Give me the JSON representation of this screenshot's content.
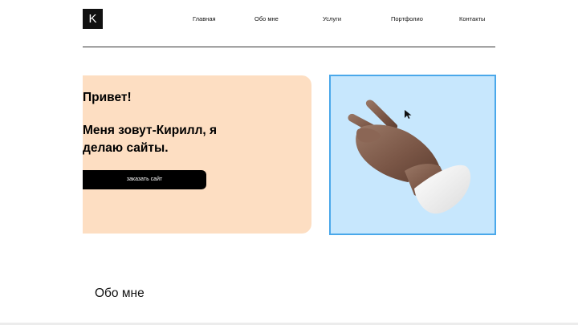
{
  "header": {
    "logo_text": "K",
    "nav": [
      "Главная",
      "Обо мне",
      "Услуги",
      "Портфолио",
      "Контакты"
    ]
  },
  "hero": {
    "greeting": "Привет!",
    "intro": "Меня зовут-Кирилл, я делаю сайты.",
    "cta_label": "заказать сайт"
  },
  "about": {
    "title": "Обо мне"
  },
  "colors": {
    "hero_card": "#fddec2",
    "image_background": "#c7e7fd",
    "image_border": "#4aa8ea",
    "button": "#000000"
  },
  "image": {
    "icon": "hand-peace-icon"
  }
}
